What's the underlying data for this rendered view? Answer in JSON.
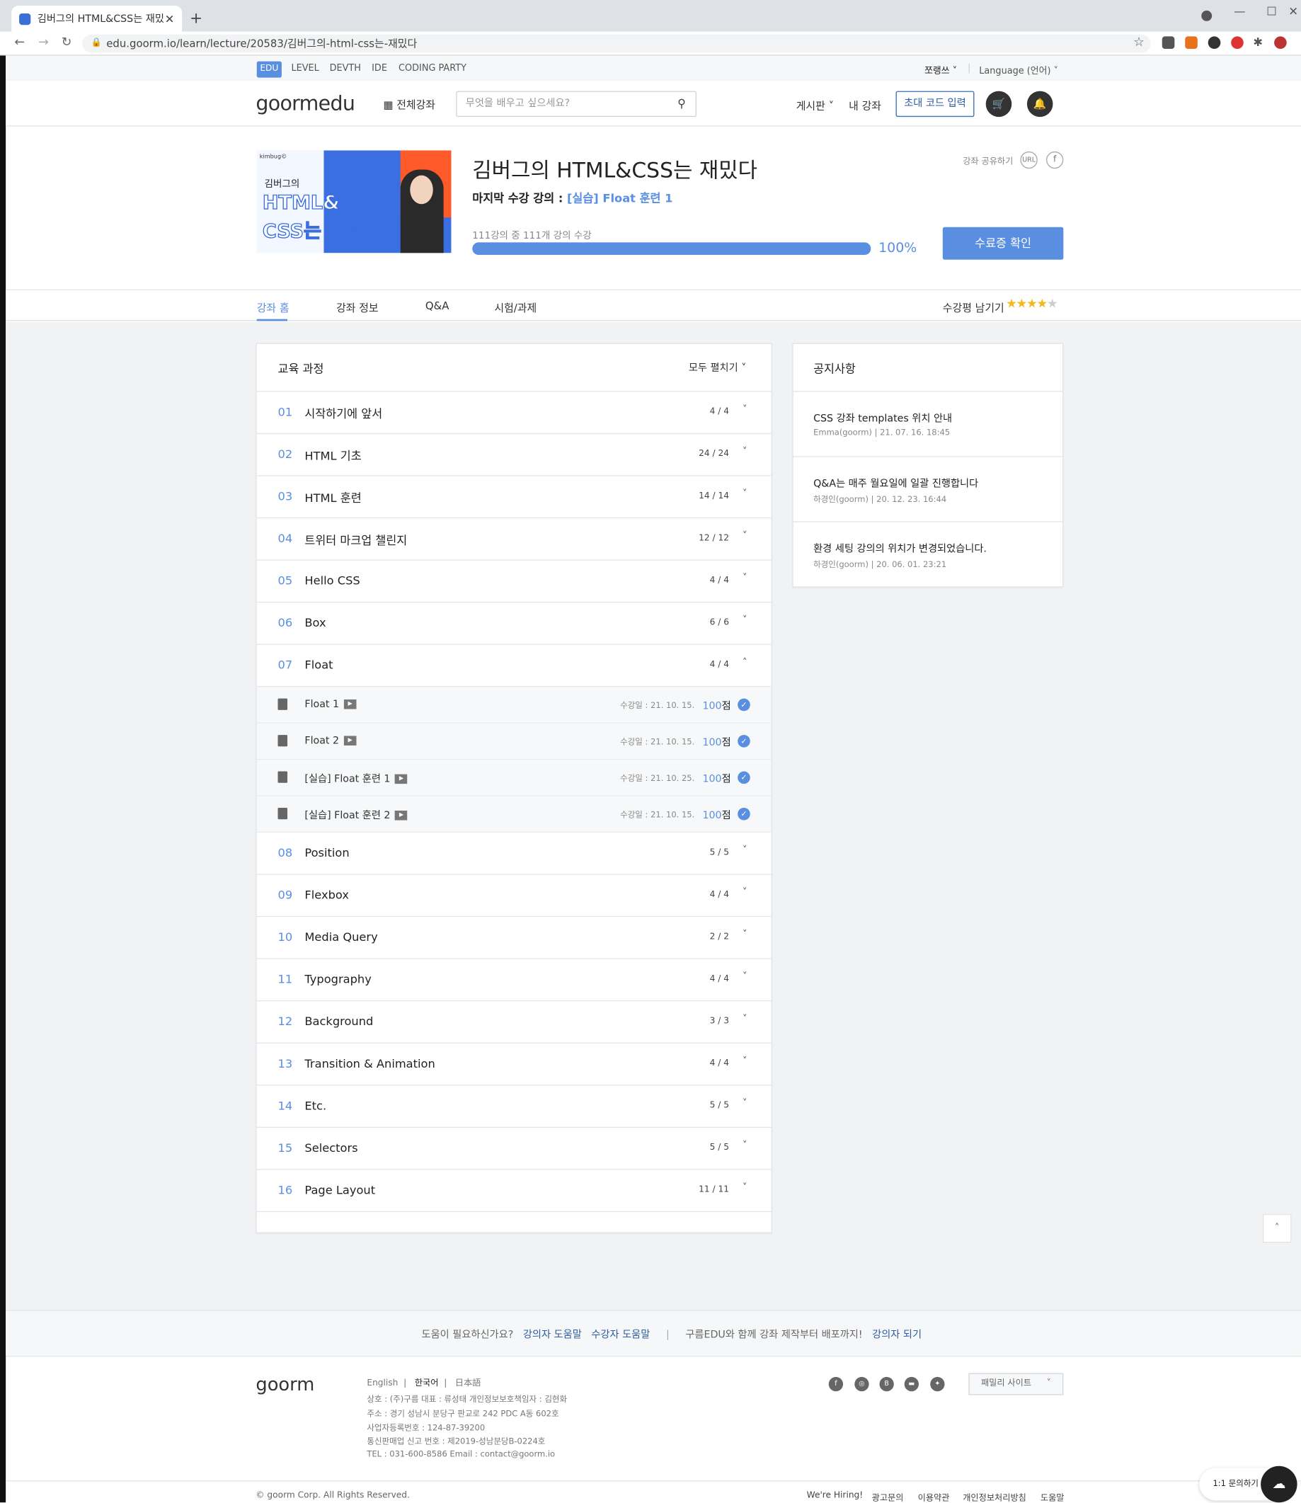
{
  "browser": {
    "tab_title": "김버그의 HTML&CSS는 재밌다",
    "url": "edu.goorm.io/learn/lecture/20583/김버그의-html-css는-재밌다"
  },
  "gnb": {
    "items": [
      "EDU",
      "LEVEL",
      "DEVTH",
      "IDE",
      "CODING PARTY"
    ],
    "user": "쪼랭쓰",
    "language": "Language (언어)"
  },
  "header": {
    "logo": "goormedu",
    "all_courses": "전체강좌",
    "search_placeholder": "무엇을 배우고 싶으세요?",
    "board": "게시판",
    "my_courses": "내 강좌",
    "invite_code": "초대 코드 입력"
  },
  "course": {
    "title": "김버그의 HTML&CSS는 재밌다",
    "last_label": "마지막 수강 강의 :",
    "last_lecture": "[실습] Float 훈련 1",
    "share": "강좌 공유하기",
    "url_btn": "URL",
    "fb_btn": "f",
    "progress_text": "111강의 중 111개 강의 수강",
    "progress": 1.0,
    "progress_pct": "100%",
    "cert_button": "수료증 확인",
    "thumb_brand": "kimbug©",
    "thumb_author": "김버그의",
    "thumb_line1": "HTML&",
    "thumb_line2": "CSS는 재밌다"
  },
  "page_tabs": [
    "강좌 홈",
    "강좌 정보",
    "Q&A",
    "시험/과제"
  ],
  "review": {
    "label": "수강평 남기기",
    "rating": 4,
    "max": 5
  },
  "curriculum": {
    "title": "교육 과정",
    "expand_all": "모두 펼치기",
    "sections": [
      {
        "num": "01",
        "name": "시작하기에 앞서",
        "count": "4 / 4"
      },
      {
        "num": "02",
        "name": "HTML 기초",
        "count": "24 / 24"
      },
      {
        "num": "03",
        "name": "HTML 훈련",
        "count": "14 / 14"
      },
      {
        "num": "04",
        "name": "트위터 마크업 챌린지",
        "count": "12 / 12"
      },
      {
        "num": "05",
        "name": "Hello CSS",
        "count": "4 / 4"
      },
      {
        "num": "06",
        "name": "Box",
        "count": "6 / 6"
      },
      {
        "num": "07",
        "name": "Float",
        "count": "4 / 4",
        "expanded": true,
        "lessons": [
          {
            "name": "Float 1",
            "date": "수강일 : 21. 10. 15.",
            "score": "100",
            "unit": "점"
          },
          {
            "name": "Float 2",
            "date": "수강일 : 21. 10. 15.",
            "score": "100",
            "unit": "점"
          },
          {
            "name": "[실습] Float 훈련 1",
            "date": "수강일 : 21. 10. 25.",
            "score": "100",
            "unit": "점"
          },
          {
            "name": "[실습] Float 훈련 2",
            "date": "수강일 : 21. 10. 15.",
            "score": "100",
            "unit": "점"
          }
        ]
      },
      {
        "num": "08",
        "name": "Position",
        "count": "5 / 5"
      },
      {
        "num": "09",
        "name": "Flexbox",
        "count": "4 / 4"
      },
      {
        "num": "10",
        "name": "Media Query",
        "count": "2 / 2"
      },
      {
        "num": "11",
        "name": "Typography",
        "count": "4 / 4"
      },
      {
        "num": "12",
        "name": "Background",
        "count": "3 / 3"
      },
      {
        "num": "13",
        "name": "Transition & Animation",
        "count": "4 / 4"
      },
      {
        "num": "14",
        "name": "Etc.",
        "count": "5 / 5"
      },
      {
        "num": "15",
        "name": "Selectors",
        "count": "5 / 5"
      },
      {
        "num": "16",
        "name": "Page Layout",
        "count": "11 / 11"
      }
    ]
  },
  "notices": {
    "title": "공지사항",
    "items": [
      {
        "title": "CSS 강좌 templates 위치 안내",
        "meta": "Emma(goorm)  |  21. 07. 16. 18:45"
      },
      {
        "title": "Q&A는 매주 월요일에 일괄 진행합니다",
        "meta": "하경인(goorm)  |  20. 12. 23. 16:44"
      },
      {
        "title": "환경 세팅 강의의 위치가 변경되었습니다.",
        "meta": "하경인(goorm)  |  20. 06. 01. 23:21"
      }
    ]
  },
  "help": {
    "question": "도움이 필요하신가요?",
    "link1": "강의자 도움말",
    "link2": "수강자 도움말",
    "sep": "|",
    "promo": "구름EDU와 함께 강좌 제작부터 배포까지!",
    "link3": "강의자 되기"
  },
  "footer": {
    "logo": "goorm",
    "langs": [
      "English",
      "한국어",
      "日本語"
    ],
    "info": [
      "상호 : (주)구름     대표 : 류성태     개인정보보호책임자 : 김현화",
      "주소 : 경기 성남시 분당구 판교로 242 PDC A동 602호",
      "사업자등록번호 : 124-87-39200",
      "통신판매업 신고 번호 : 제2019-성남분당B-0224호",
      "TEL : 031-600-8586     Email : contact@goorm.io"
    ],
    "family": "패밀리 사이트",
    "copyright": "© goorm Corp. All Rights Reserved.",
    "links": [
      "We're Hiring!",
      "광고문의",
      "이용약관",
      "개인정보처리방침",
      "도움말"
    ],
    "inquiry": "1:1 문의하기"
  },
  "colors": {
    "accent": "#5a8ee0",
    "dark_link": "#2e5ca1"
  }
}
